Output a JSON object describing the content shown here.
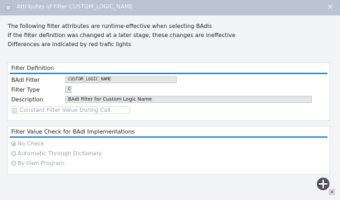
{
  "dialog": {
    "title": "Attributes of Filter CUSTOM_LOGIC_NAME",
    "close_glyph": "×"
  },
  "intro": {
    "lines": [
      "The following filter attributes are runtime-effective when selecting BAdIs",
      "If the filter definition was changed at a later stage, these changes are ineffective",
      "Differences are indicated by red trafic lights"
    ]
  },
  "filter_definition": {
    "title": "Filter Definition",
    "badi_filter_label": "BAdI Filter",
    "badi_filter_value": "CUSTOM_LOGIC_NAME",
    "filter_type_label": "Filter Type",
    "filter_type_value": "C",
    "description_label": "Description",
    "description_value": "BAdI Filter for Custom Logic Name",
    "constant_checkbox_label": "Constant Filter Value During Call",
    "constant_checked": false
  },
  "value_check": {
    "title": "Filter Value Check for BAdI Implementations",
    "options": [
      {
        "label": "No Check",
        "selected": true
      },
      {
        "label": "Automatic Through Dictionary",
        "selected": false
      },
      {
        "label": "By Own Program",
        "selected": false
      }
    ]
  },
  "icons": {
    "title": "dialog-icon",
    "close": "close-icon",
    "add": "plus-circle-icon",
    "status": "error-badge-icon"
  },
  "colors": {
    "accent": "#2d84d2",
    "titlebar": "#b9c3d1",
    "error": "#d9362b"
  }
}
